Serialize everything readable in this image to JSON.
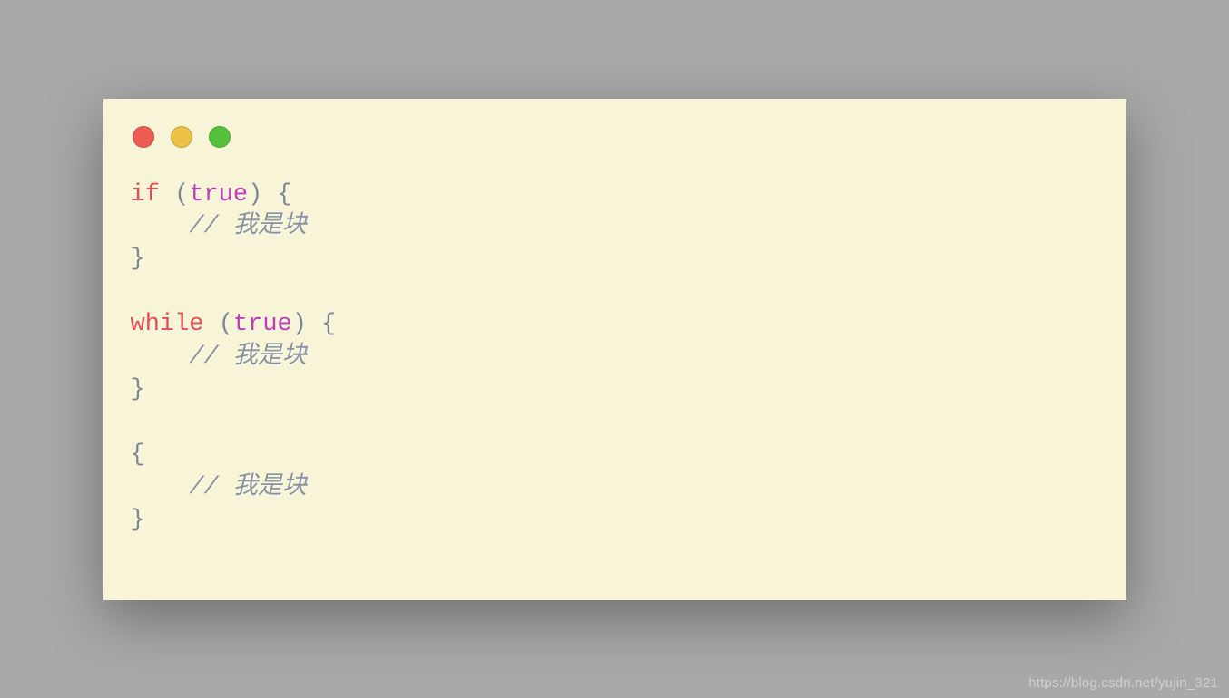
{
  "code": {
    "line1_keyword": "if",
    "line1_pre": " (",
    "line1_bool": "true",
    "line1_post": ") {",
    "line2_indent": "    ",
    "line2_comment": "// 我是块",
    "line3": "}",
    "blank1": "",
    "line4_keyword": "while",
    "line4_pre": " (",
    "line4_bool": "true",
    "line4_post": ") {",
    "line5_indent": "    ",
    "line5_comment": "// 我是块",
    "line6": "}",
    "blank2": "",
    "line7": "{",
    "line8_indent": "    ",
    "line8_comment": "// 我是块",
    "line9": "}"
  },
  "watermark": "https://blog.csdn.net/yujin_321"
}
